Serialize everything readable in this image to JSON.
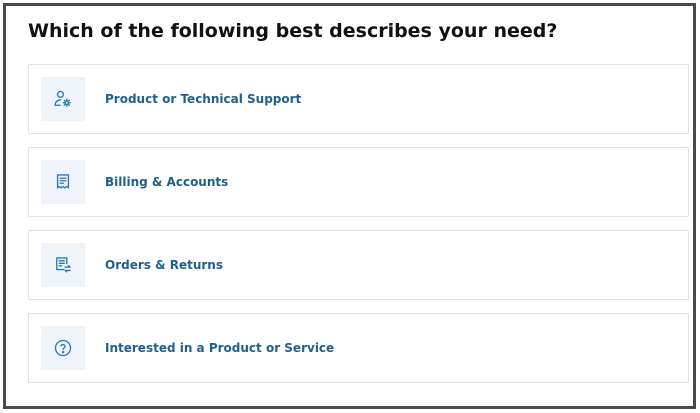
{
  "page": {
    "title": "Which of the following best describes your need?"
  },
  "options": [
    {
      "label": "Product or Technical Support",
      "icon": "user-gear-icon"
    },
    {
      "label": "Billing & Accounts",
      "icon": "receipt-icon"
    },
    {
      "label": "Orders & Returns",
      "icon": "document-return-icon"
    },
    {
      "label": "Interested in a Product or Service",
      "icon": "question-circle-icon"
    }
  ],
  "colors": {
    "label": "#1f5f8e",
    "icon": "#2b77b4",
    "icon_background": "#eef4f9",
    "border": "#dfe3e7",
    "frame": "#4a4a4a"
  }
}
